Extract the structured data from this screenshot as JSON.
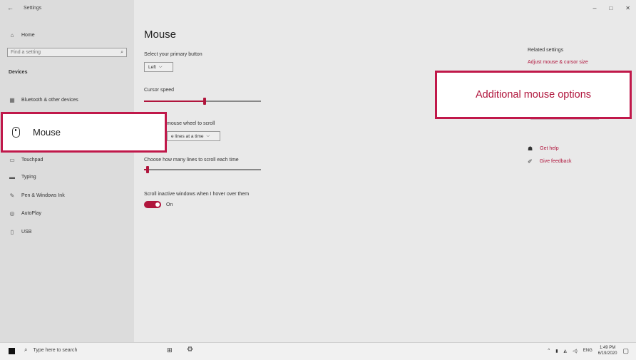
{
  "window": {
    "back_icon": "back-arrow-icon",
    "title": "Settings",
    "controls": [
      "minimize-icon",
      "maximize-icon",
      "close-icon"
    ]
  },
  "sidebar": {
    "home_label": "Home",
    "search_placeholder": "Find a setting",
    "section_label": "Devices",
    "items": [
      {
        "label": "Bluetooth & other devices",
        "icon": "bluetooth-devices-icon"
      },
      {
        "label": "Touchpad",
        "icon": "touchpad-icon"
      },
      {
        "label": "Typing",
        "icon": "keyboard-icon"
      },
      {
        "label": "Pen & Windows Ink",
        "icon": "pen-icon"
      },
      {
        "label": "AutoPlay",
        "icon": "autoplay-icon"
      },
      {
        "label": "USB",
        "icon": "usb-icon"
      }
    ]
  },
  "main": {
    "page_title": "Mouse",
    "primary_button_label": "Select your primary button",
    "primary_button_value": "Left",
    "cursor_speed_label": "Cursor speed",
    "cursor_speed_level": 0.52,
    "wheel_scroll_label": "mouse wheel to scroll",
    "wheel_scroll_value": "e lines at a time",
    "lines_label": "Choose how many lines to scroll each time",
    "lines_level": 0.03,
    "inactive_label": "Scroll inactive windows when I hover over them",
    "toggle_state": "On"
  },
  "related": {
    "heading": "Related settings",
    "adjust_link": "Adjust mouse & cursor size",
    "get_help": "Get help",
    "give_feedback": "Give feedback"
  },
  "callouts": {
    "mouse_label": "Mouse",
    "additional_options": "Additional mouse options"
  },
  "taskbar": {
    "search_placeholder": "Type here to search",
    "lang": "ENG",
    "time": "1:49 PM",
    "date": "6/19/2020"
  },
  "colors": {
    "accent": "#b0153c",
    "callout_border": "#c0184a"
  }
}
